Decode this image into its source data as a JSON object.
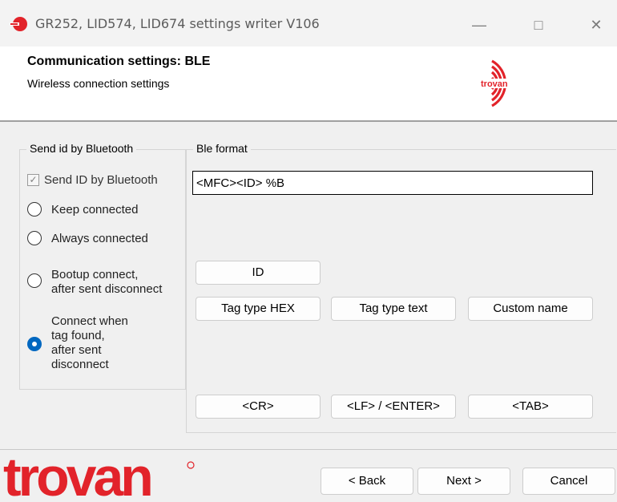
{
  "window": {
    "title": "GR252, LID574, LID674 settings writer V106",
    "minimize_icon": "minimize-icon",
    "maximize_icon": "maximize-icon",
    "close_icon": "close-icon"
  },
  "header": {
    "title": "Communication settings: BLE",
    "subtitle": "Wireless connection settings",
    "logo_text": "trovan"
  },
  "bluetooth_group": {
    "legend": "Send id by Bluetooth",
    "send_id_checkbox": {
      "label": "Send ID by Bluetooth",
      "checked": true
    },
    "options": [
      {
        "label_lines": [
          "Keep connected"
        ],
        "checked": false
      },
      {
        "label_lines": [
          "Always connected"
        ],
        "checked": false
      },
      {
        "label_lines": [
          "Bootup connect,",
          "after sent disconnect"
        ],
        "checked": false
      },
      {
        "label_lines": [
          "Connect when",
          "tag found,",
          "after sent",
          "disconnect"
        ],
        "checked": true
      }
    ]
  },
  "ble_group": {
    "legend": "Ble format",
    "format_value": "<MFC><ID> %B",
    "buttons": {
      "id": "ID",
      "tag_type_hex": "Tag type HEX",
      "tag_type_text": "Tag type text",
      "custom_name": "Custom name",
      "cr": "<CR>",
      "lf_enter": "<LF> / <ENTER>",
      "tab": "<TAB>"
    }
  },
  "footer": {
    "logo_text": "trovan",
    "back": "< Back",
    "next": "Next >",
    "cancel": "Cancel"
  },
  "colors": {
    "brand_red": "#e2232a",
    "radio_accent": "#0067c0"
  }
}
